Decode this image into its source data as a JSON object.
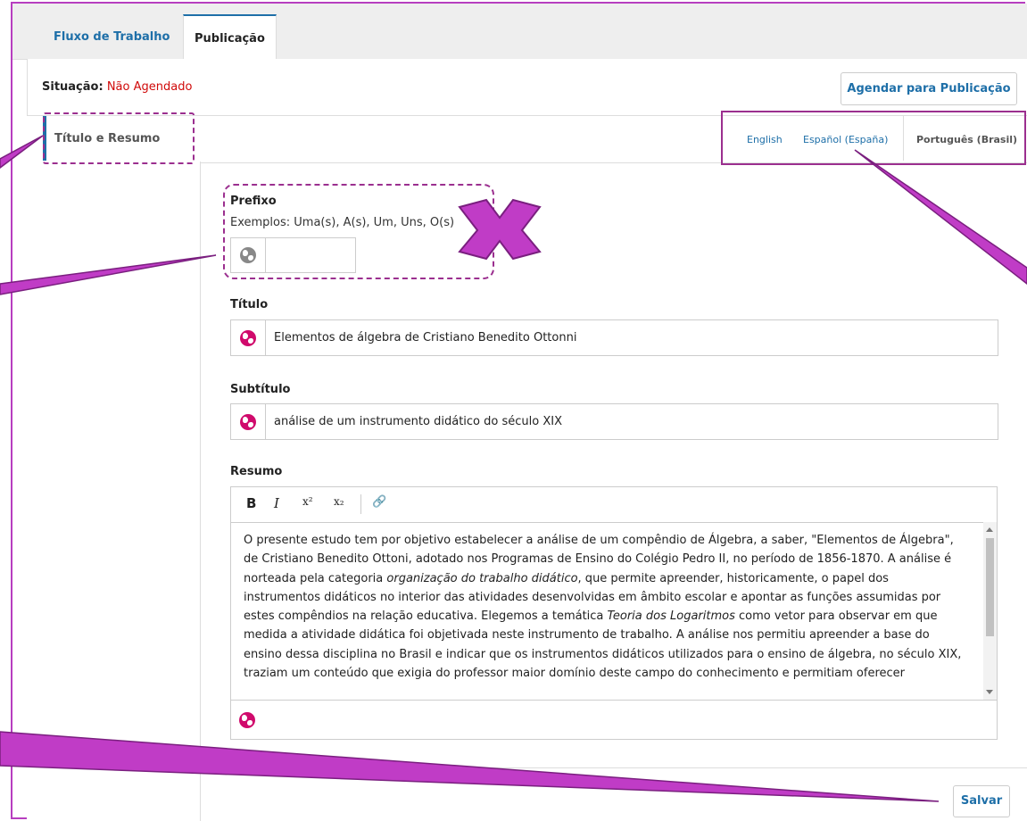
{
  "tabs": [
    {
      "label": "Fluxo de Trabalho",
      "active": false
    },
    {
      "label": "Publicação",
      "active": true
    }
  ],
  "status": {
    "label": "Situação:",
    "value": "Não Agendado"
  },
  "schedule_button": "Agendar para Publicação",
  "section": {
    "title": "Título e Resumo"
  },
  "locales": [
    {
      "label": "English",
      "active": false
    },
    {
      "label": "Español (España)",
      "active": false
    },
    {
      "label": "Português (Brasil)",
      "active": true
    }
  ],
  "form": {
    "prefix": {
      "label": "Prefixo",
      "hint": "Exemplos: Uma(s), A(s), Um, Uns, O(s)",
      "value": ""
    },
    "title": {
      "label": "Título",
      "value": "Elementos de álgebra de Cristiano Benedito Ottonni"
    },
    "subtitle": {
      "label": "Subtítulo",
      "value": "análise de um instrumento didático do século XIX"
    },
    "abstract": {
      "label": "Resumo",
      "toolbar": {
        "bold": "B",
        "italic": "I",
        "superscript": "x²",
        "subscript": "x₂",
        "link": "🔗"
      },
      "parts": {
        "p1": "O presente estudo tem por objetivo estabelecer a análise de um compêndio de Álgebra, a saber, \"Elementos de Álgebra\", de Cristiano Benedito Ottoni, adotado nos Programas de Ensino do Colégio Pedro II, no período de 1856-1870. A análise é norteada pela categoria ",
        "em1": "organização do trabalho didático",
        "p2": ", que permite apreender, historicamente, o papel dos instrumentos didáticos no interior das atividades desenvolvidas em âmbito escolar e apontar as funções assumidas por estes compêndios na relação educativa. Elegemos a temática ",
        "em2": "Teoria dos Logaritmos",
        "p3": " como vetor para observar em que medida a atividade didática foi objetivada neste instrumento de trabalho. A análise nos permitiu apreender a base do ensino dessa disciplina no Brasil e indicar que os instrumentos didáticos utilizados para o ensino de álgebra, no século XIX, traziam um conteúdo que exigia do professor maior domínio deste campo do conhecimento e permitiam oferecer"
      }
    }
  },
  "save_button": "Salvar",
  "colors": {
    "accent": "#1e6fa8",
    "error": "#d00a0a",
    "annotation": "#c03cc6",
    "globe": "#d00a6c"
  },
  "icons": [
    "globe-icon",
    "bold-icon",
    "italic-icon",
    "superscript-icon",
    "subscript-icon",
    "link-icon",
    "close-x-icon"
  ]
}
